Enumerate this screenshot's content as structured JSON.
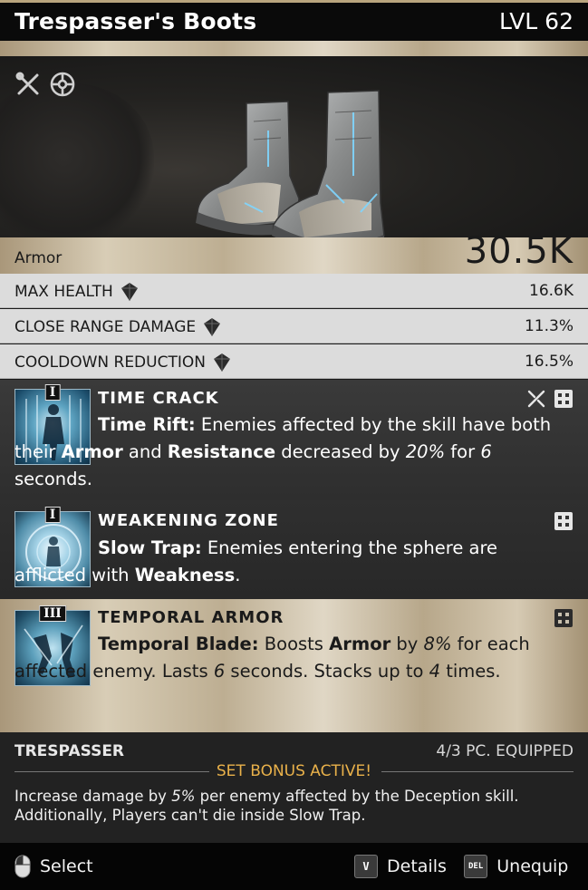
{
  "item": {
    "name": "Trespasser's Boots",
    "level": "LVL 62",
    "type": "Armor",
    "armor_value": "30.5K"
  },
  "stats": [
    {
      "name": "MAX HEALTH",
      "value": "16.6K"
    },
    {
      "name": "CLOSE RANGE DAMAGE",
      "value": "11.3%"
    },
    {
      "name": "COOLDOWN REDUCTION",
      "value": "16.5%"
    }
  ],
  "perks": [
    {
      "tier": "I",
      "title": "TIME CRACK",
      "desc_lead": "Time Rift:",
      "desc_1": " Enemies affected by the skill have both their ",
      "desc_b1": "Armor",
      "desc_2": " and ",
      "desc_b2": "Resistance",
      "desc_3": " decreased by ",
      "desc_i1": "20%",
      "desc_4": " for ",
      "desc_i2": "6",
      "desc_5": " seconds."
    },
    {
      "tier": "I",
      "title": "WEAKENING ZONE",
      "desc_lead": "Slow Trap:",
      "desc_1": " Enemies entering the sphere are afflicted with ",
      "desc_b1": "Weakness",
      "desc_2": "."
    },
    {
      "tier": "III",
      "title": "TEMPORAL ARMOR",
      "desc_lead": "Temporal Blade:",
      "desc_1": " Boosts ",
      "desc_b1": "Armor",
      "desc_2": " by ",
      "desc_i1": "8%",
      "desc_3": " for each affected enemy. Lasts ",
      "desc_i2": "6",
      "desc_4": " seconds. Stacks up to ",
      "desc_i3": "4",
      "desc_5": " times."
    }
  ],
  "set_bonus": {
    "name": "TRESPASSER",
    "count": "4/3 PC. EQUIPPED",
    "status": "SET BONUS ACTIVE!",
    "desc_1": "Increase damage by ",
    "desc_i1": "5%",
    "desc_2": " per enemy affected by the Deception skill. Additionally, Players can't die inside Slow Trap."
  },
  "footer": {
    "select_label": "Select",
    "details_key": "V",
    "details_label": "Details",
    "unequip_key": "DEL",
    "unequip_label": "Unequip"
  },
  "colors": {
    "header_bg": "#0a0a0a",
    "stat_bg": "#dcdcdc",
    "set_active": "#e9b14a",
    "perk_icon": "#5ea4c2"
  },
  "icons": [
    "mod-tools-icon",
    "crosshair-icon",
    "mod-tools-icon",
    "slot-grid-icon",
    "gem-icon",
    "mouse-icon"
  ]
}
